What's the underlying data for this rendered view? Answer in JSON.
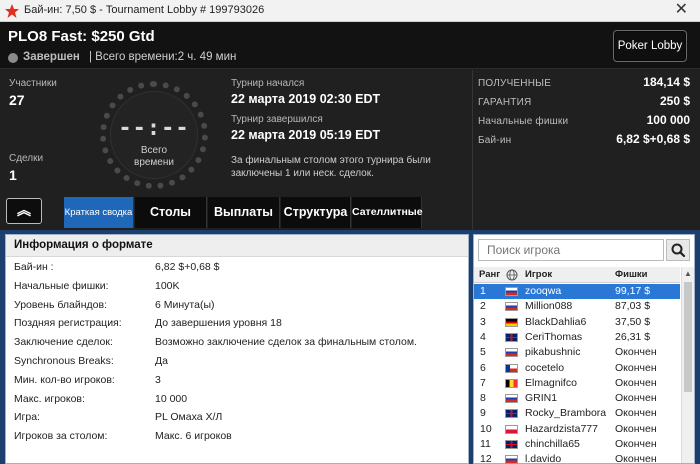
{
  "window": {
    "title": "Бай-ин: 7,50 $ - Tournament Lobby # 199793026",
    "close_glyph": "✕"
  },
  "header": {
    "tournament_name": "PLO8 Fast: $250 Gtd",
    "status": "Завершен",
    "total_time": "| Всего времени:2 ч. 49 мин",
    "poker_lobby_button": "Poker Lobby",
    "status_color": "#8a8a8a"
  },
  "info": {
    "participants_label": "Участники",
    "participants_value": "27",
    "deals_label": "Сделки",
    "deals_value": "1",
    "clock_digits": "--:--",
    "clock_label_1": "Всего",
    "clock_label_2": "времени",
    "started_label": "Турнир начался",
    "started_value": "22 марта 2019  02:30 EDT",
    "finished_label": "Турнир завершился",
    "finished_value": "22 марта 2019  05:19 EDT",
    "final_table_note": "За финальным столом этого турнира были заключены 1 или неск. сделок.",
    "received_label": "ПОЛУЧЕННЫЕ",
    "received_value": "184,14 $",
    "guarantee_label": "ГАРАНТИЯ",
    "guarantee_value": "250 $",
    "starting_chips_label": "Начальные фишки",
    "starting_chips_value": "100 000",
    "buyin_label": "Бай-ин",
    "buyin_value": "6,82 $+0,68 $"
  },
  "tabs": {
    "collapse_glyph": "︽",
    "items": [
      {
        "label": "Краткая сводка",
        "active": true
      },
      {
        "label": "Столы",
        "active": false
      },
      {
        "label": "Выплаты",
        "active": false
      },
      {
        "label": "Структура",
        "active": false
      },
      {
        "label": "Сателлитные",
        "active": false
      }
    ]
  },
  "format": {
    "title": "Информация о формате",
    "rows": [
      {
        "key": "Бай-ин :",
        "value": "6,82 $+0,68 $"
      },
      {
        "key": "Начальные фишки:",
        "value": "100K"
      },
      {
        "key": "Уровень блайндов:",
        "value": "6 Минута(ы)"
      },
      {
        "key": "Поздняя регистрация:",
        "value": "До завершения уровня 18"
      },
      {
        "key": "Заключение сделок:",
        "value": "Возможно заключение сделок за финальным столом."
      },
      {
        "key": "Synchronous Breaks:",
        "value": "Да"
      },
      {
        "key": "Мин. кол-во игроков:",
        "value": "3"
      },
      {
        "key": "Макс. игроков:",
        "value": "10 000"
      },
      {
        "key": "Игра:",
        "value": "PL Омаха Х/Л"
      },
      {
        "key": "Игроков за столом:",
        "value": "Макс. 6 игроков"
      }
    ]
  },
  "players": {
    "search_placeholder": "Поиск игрока",
    "headers": {
      "rank": "Ранг",
      "player": "Игрок",
      "chips": "Фишки"
    },
    "rows": [
      {
        "rank": "1",
        "name": "zooqwa",
        "prize": "99,17 $",
        "flag": "ru",
        "selected": true
      },
      {
        "rank": "2",
        "name": "Million088",
        "prize": "87,03 $",
        "flag": "ru",
        "selected": false
      },
      {
        "rank": "3",
        "name": "BlackDahlia6",
        "prize": "37,50 $",
        "flag": "de",
        "selected": false
      },
      {
        "rank": "4",
        "name": "CeriThomas",
        "prize": "26,31 $",
        "flag": "gb",
        "selected": false
      },
      {
        "rank": "5",
        "name": "pikabushnic",
        "prize": "Окончен",
        "flag": "ru",
        "selected": false
      },
      {
        "rank": "6",
        "name": "cocetelo",
        "prize": "Окончен",
        "flag": "cl",
        "selected": false
      },
      {
        "rank": "7",
        "name": "Elmagnifco",
        "prize": "Окончен",
        "flag": "be",
        "selected": false
      },
      {
        "rank": "8",
        "name": "GRIN1",
        "prize": "Окончен",
        "flag": "ru",
        "selected": false
      },
      {
        "rank": "9",
        "name": "Rocky_Brambora",
        "prize": "Окончен",
        "flag": "gb",
        "selected": false
      },
      {
        "rank": "10",
        "name": "Hazardzista777",
        "prize": "Окончен",
        "flag": "pl",
        "selected": false
      },
      {
        "rank": "11",
        "name": "chinchilla65",
        "prize": "Окончен",
        "flag": "gb",
        "selected": false
      },
      {
        "rank": "12",
        "name": "l.davido",
        "prize": "Окончен",
        "flag": "ru",
        "selected": false
      }
    ]
  },
  "colors": {
    "accent": "#1f67b8",
    "selected_row": "#2a78d6",
    "panel_bg": "#1c3f6e"
  }
}
